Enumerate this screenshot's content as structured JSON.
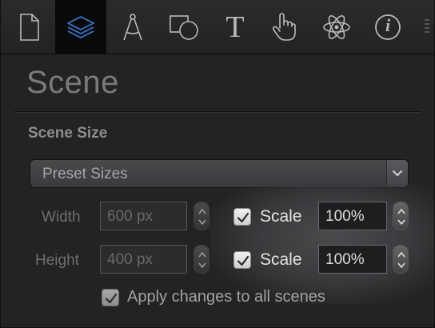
{
  "toolbar": {
    "tools": [
      {
        "name": "document-icon",
        "active": false
      },
      {
        "name": "layers-icon",
        "active": true
      },
      {
        "name": "compass-icon",
        "active": false
      },
      {
        "name": "shapes-icon",
        "active": false
      },
      {
        "name": "text-icon",
        "active": false
      },
      {
        "name": "hand-pointer-icon",
        "active": false
      },
      {
        "name": "atom-icon",
        "active": false
      },
      {
        "name": "info-icon",
        "active": false
      }
    ],
    "text_tool_glyph": "T",
    "info_glyph": "i"
  },
  "header": {
    "title": "Scene"
  },
  "scene_size": {
    "section_label": "Scene Size",
    "preset": {
      "label": "Preset Sizes"
    },
    "width": {
      "label": "Width",
      "value": "600 px",
      "scale_checked": true,
      "scale_label": "Scale",
      "scale_value": "100%"
    },
    "height": {
      "label": "Height",
      "value": "400 px",
      "scale_checked": true,
      "scale_label": "Scale",
      "scale_value": "100%"
    },
    "apply_all": {
      "checked": true,
      "label": "Apply changes to all scenes"
    }
  },
  "colors": {
    "active_tool": "#3c78c8",
    "background": "#232325"
  }
}
